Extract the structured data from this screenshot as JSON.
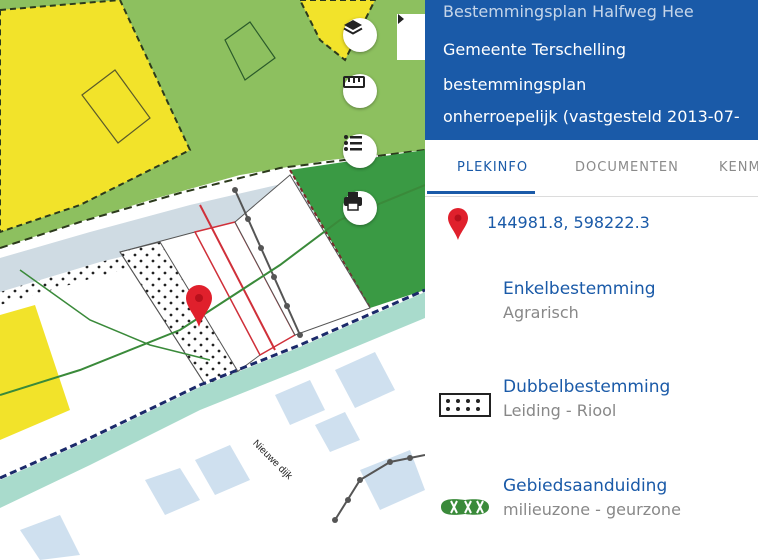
{
  "map": {
    "street_label": "Nieuwe dijk",
    "tools": [
      {
        "id": "layers",
        "icon": "layers-icon"
      },
      {
        "id": "measure",
        "icon": "ruler-icon"
      },
      {
        "id": "legend",
        "icon": "list-icon"
      },
      {
        "id": "print",
        "icon": "printer-icon"
      }
    ],
    "colors": {
      "agrarisch": "#8dc05f",
      "wonen": "#f2e32a",
      "bos": "#3a9a44",
      "water": "#a9dbcc",
      "road": "#cfdbe3",
      "building": "#cfe0ef"
    }
  },
  "panel": {
    "collapse_icon": "chevron-right-icon",
    "header": {
      "title": "Bestemmingsplan Halfweg Hee",
      "municipality": "Gemeente Terschelling",
      "plan_type": "bestemmingsplan",
      "status": "onherroepelijk (vastgesteld 2013-07-"
    },
    "tabs": [
      {
        "label": "PLEKINFO",
        "active": true
      },
      {
        "label": "DOCUMENTEN",
        "active": false
      },
      {
        "label": "KENM",
        "active": false
      }
    ],
    "location": {
      "icon": "location-pin-icon",
      "coordinates": "144981.8, 598222.3"
    },
    "sections": [
      {
        "title": "Enkelbestemming",
        "value": "Agrarisch",
        "icon": "none"
      },
      {
        "title": "Dubbelbestemming",
        "value": "Leiding - Riool",
        "icon": "dotted-pattern-icon"
      },
      {
        "title": "Gebiedsaanduiding",
        "value": "milieuzone - geurzone",
        "icon": "hatched-area-icon"
      }
    ]
  }
}
